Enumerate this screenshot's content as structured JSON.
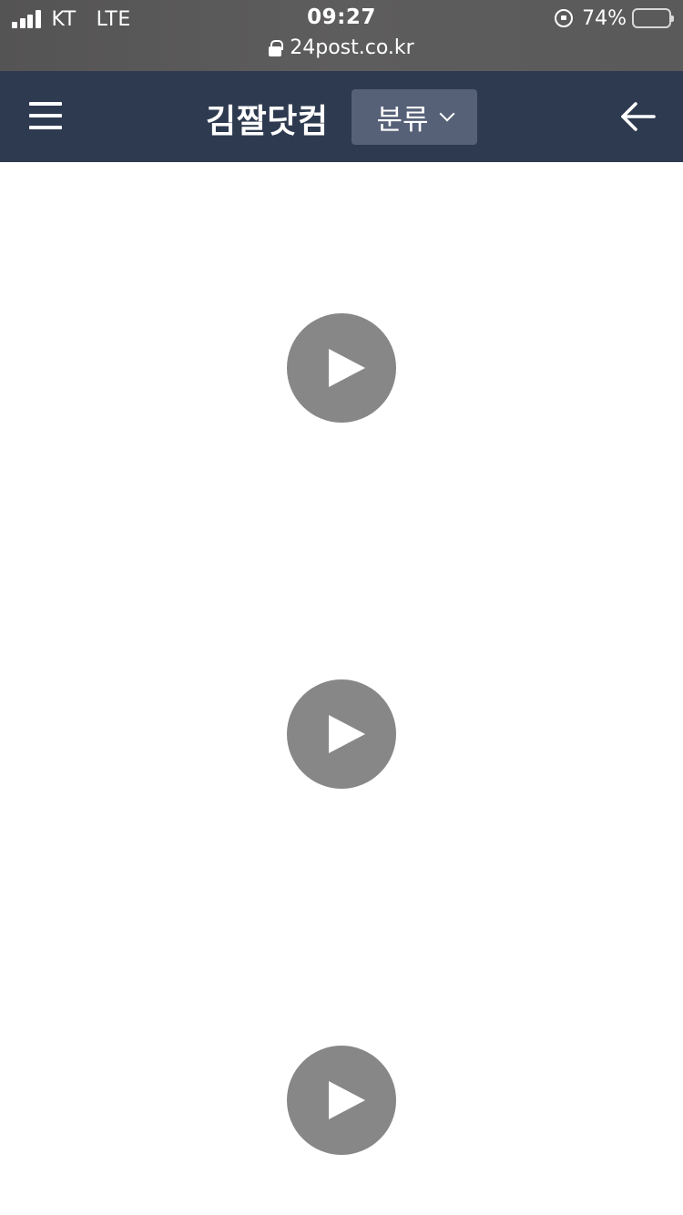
{
  "status_bar": {
    "carrier": "KT",
    "network": "LTE",
    "time": "09:27",
    "battery_percent": "74%",
    "battery_level": 0.74,
    "url": "24post.co.kr"
  },
  "nav": {
    "menu_icon": "hamburger-menu-icon",
    "site_title": "김짤닷컴",
    "category_label": "분류",
    "category_icon": "chevron-down-icon",
    "back_icon": "arrow-left-icon"
  },
  "videos": [
    {
      "icon": "play-icon"
    },
    {
      "icon": "play-icon"
    },
    {
      "icon": "play-icon"
    }
  ],
  "colors": {
    "nav_background": "#2e3a4f",
    "category_button": "#566178",
    "play_button": "#878787",
    "battery_fill": "#ffd60a"
  }
}
